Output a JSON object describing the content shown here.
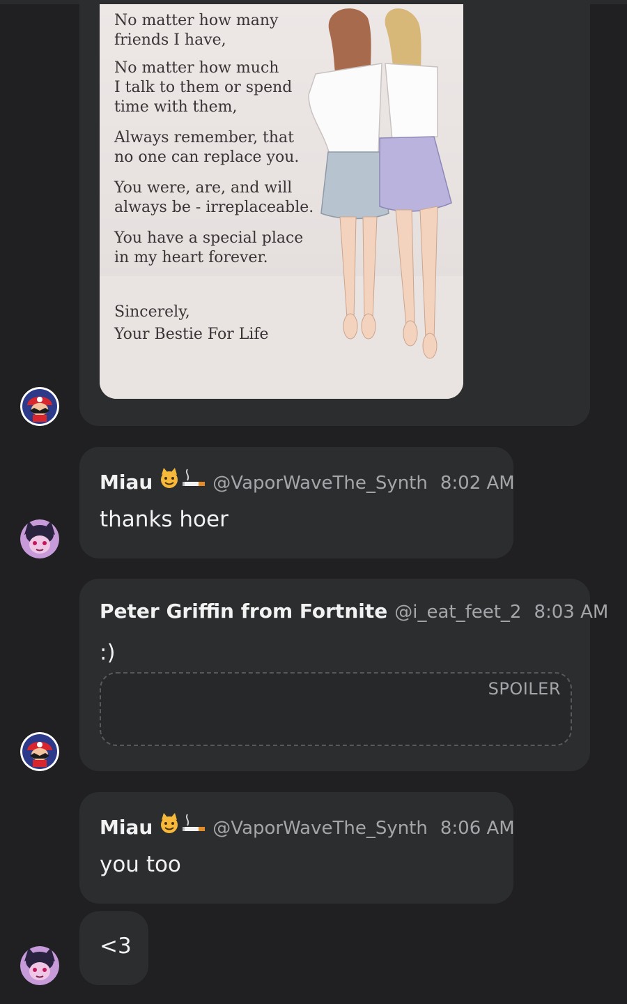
{
  "image_card": {
    "lines": [
      [
        "No matter how many",
        "friends I have,"
      ],
      [
        "No matter how much",
        "I talk to them or spend",
        "time with them,"
      ],
      [
        "Always remember, that",
        "no one can replace you."
      ],
      [
        "You were, are, and will",
        "always be - irreplaceable."
      ],
      [
        "You have a special place",
        "in my heart forever."
      ],
      [
        "Sincerely,",
        "Your Bestie For Life"
      ]
    ]
  },
  "messages": [
    {
      "name": "Miau",
      "handle": "@VaporWaveThe_Synth",
      "time": "8:02 AM",
      "text": "thanks hoer"
    },
    {
      "name": "Peter Griffin from Fortnite",
      "handle": "@i_eat_feet_2",
      "time": "8:03 AM",
      "text": ":)",
      "spoiler_label": "SPOILER"
    },
    {
      "name": "Miau",
      "handle": "@VaporWaveThe_Synth",
      "time": "8:06 AM",
      "text": "you too",
      "followup": "<3"
    }
  ],
  "colors": {
    "background": "#202022",
    "bubble": "#2c2d2f",
    "text": "#f2f2f2",
    "muted": "#a4a6a9"
  }
}
